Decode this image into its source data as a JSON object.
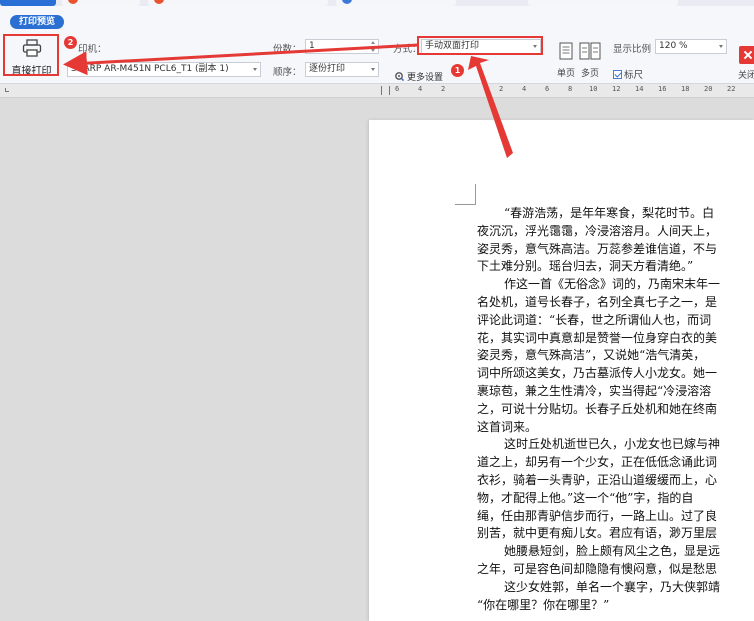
{
  "toolbar": {
    "preview_tab": "打印预览",
    "print_button_label": "直接打印",
    "printer_label": "印机：",
    "printer_value": "SHARP AR-M451N PCL6_T1 (副本 1)",
    "copies_label": "份数：",
    "copies_value": "1",
    "order_label": "顺序：",
    "order_value": "逐份打印",
    "mode_label": "方式：",
    "mode_value": "手动双面打印",
    "more_settings_label": "更多设置",
    "single_page_label": "单页",
    "multi_page_label": "多页",
    "zoom_label": "显示比例",
    "zoom_value": "120 %",
    "ruler_checkbox_label": "标尺",
    "close_label": "关闭"
  },
  "badges": {
    "b1": "1",
    "b2": "2"
  },
  "ruler": {
    "marks": [
      "6",
      "4",
      "2",
      "2",
      "4",
      "6",
      "8",
      "10",
      "12",
      "14",
      "16",
      "18",
      "20",
      "22"
    ]
  },
  "document": {
    "lines": [
      "“春游浩荡，是年年寒食，梨花时节。白",
      "夜沉沉，浮光霭霭，冷浸溶溶月。人间天上，",
      "姿灵秀，意气殊高洁。万蕊参差谁信道，不与",
      "下土难分别。瑶台归去，洞天方看清绝。”",
      "作这一首《无俗念》词的，乃南宋末年一",
      "名处机，道号长春子，名列全真七子之一，是",
      "评论此词道：“长春，世之所谓仙人也，而词",
      "花，其实词中真意却是赞誉一位身穿白衣的美",
      "姿灵秀，意气殊高洁”，又说她“浩气清英，",
      "词中所颂这美女，乃古墓派传人小龙女。她一",
      "裹琼苞，兼之生性清冷，实当得起“冷浸溶溶",
      "之，可说十分贴切。长春子丘处机和她在终南",
      "这首词来。",
      "这时丘处机逝世已久，小龙女也已嫁与神",
      "道之上，却另有一个少女，正在低低念诵此词",
      "衣衫，骑着一头青驴，正沿山道缓缓而上，心",
      "物，才配得上他。”这一个“他”字，指的自",
      "绳，任由那青驴信步而行，一路上山。过了良",
      "别苦，就中更有痴儿女。君应有语，渺万里层",
      "她腰悬短剑，脸上颇有风尘之色，显是远",
      "之年，可是容色间却隐隐有懊闷意，似是愁思",
      "这少女姓郭，单名一个襄字，乃大侠郭靖",
      "“你在哪里？你在哪里？”"
    ]
  }
}
